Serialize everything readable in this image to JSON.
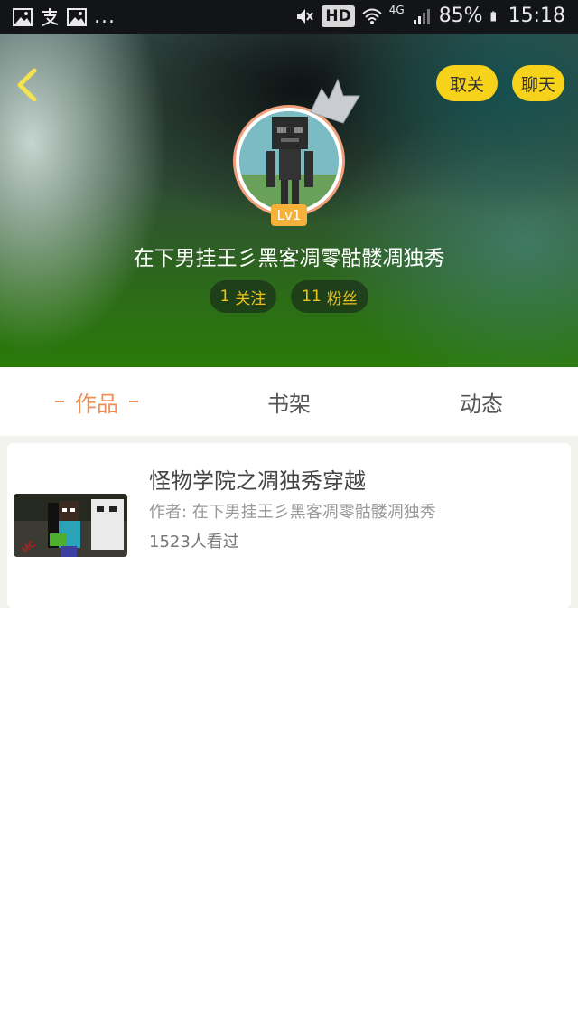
{
  "status_bar": {
    "left_icons": [
      "image-icon",
      "alipay-icon",
      "image-icon"
    ],
    "overflow_dots": "...",
    "hd_badge": "HD",
    "network_type": "4G",
    "battery_percent": "85%",
    "time": "15:18"
  },
  "header": {
    "unfollow_label": "取关",
    "chat_label": "聊天",
    "level_badge": "Lv1",
    "username": "在下男挂王彡黑客凋零骷髅凋独秀",
    "following_count": "1",
    "following_label": "关注",
    "followers_count": "11",
    "followers_label": "粉丝"
  },
  "tabs": [
    {
      "label": "作品",
      "active": true
    },
    {
      "label": "书架",
      "active": false
    },
    {
      "label": "动态",
      "active": false
    }
  ],
  "works": [
    {
      "title": "怪物学院之凋独秀穿越",
      "author": "作者: 在下男挂王彡黑客凋零骷髅凋独秀",
      "views": "1523人看过"
    }
  ],
  "colors": {
    "accent_yellow": "#f7d21a",
    "active_tab": "#f08f55",
    "level_badge": "#f5b13a",
    "stat_text": "#f1c21a"
  }
}
